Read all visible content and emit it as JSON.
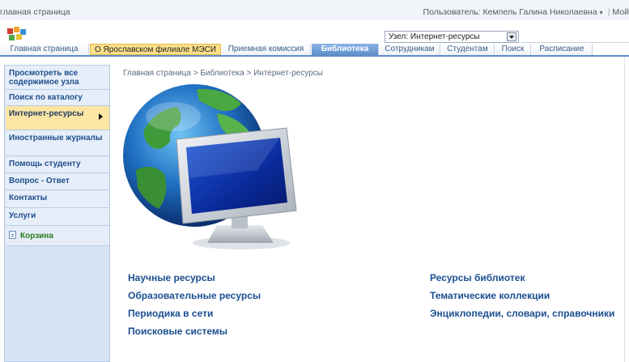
{
  "top": {
    "home_link": "главная страница",
    "user_label": "Пользователь: Кемпель Галина Николаевна",
    "user_menu_arrow": "▾",
    "separator": "|",
    "my_site": "Мой"
  },
  "scope": {
    "selected": "Узел: Интернет-ресурсы"
  },
  "tabs": [
    "Главная страница",
    "О Ярославском филиале МЭСИ",
    "Приемная комиссия",
    "Библиотека",
    "Сотрудникам",
    "Студентам",
    "Поиск",
    "Расписание"
  ],
  "leftnav": {
    "items": [
      "Просмотреть все содержимое узла",
      "Поиск по каталогу",
      "Интернет-ресурсы",
      "Иностранные журналы",
      "Помощь студенту",
      "Вопрос - Ответ",
      "Контакты",
      "Услуги"
    ],
    "recycle_bin": "Корзина"
  },
  "breadcrumb": "Главная страница > Библиотека > Интернет-ресурсы",
  "links_left": [
    "Научные ресурсы",
    "Образовательные ресурсы",
    "Периодика в сети",
    "Поисковые системы"
  ],
  "links_right": [
    "Ресурсы библиотек",
    "Тематические коллекции",
    "Энциклопедии, словари, справочники"
  ],
  "colors": {
    "accent": "#5f8ec8",
    "highlight_tab": "#fde08a",
    "nav_bg": "#d7e4f5",
    "link": "#1c4f91"
  }
}
